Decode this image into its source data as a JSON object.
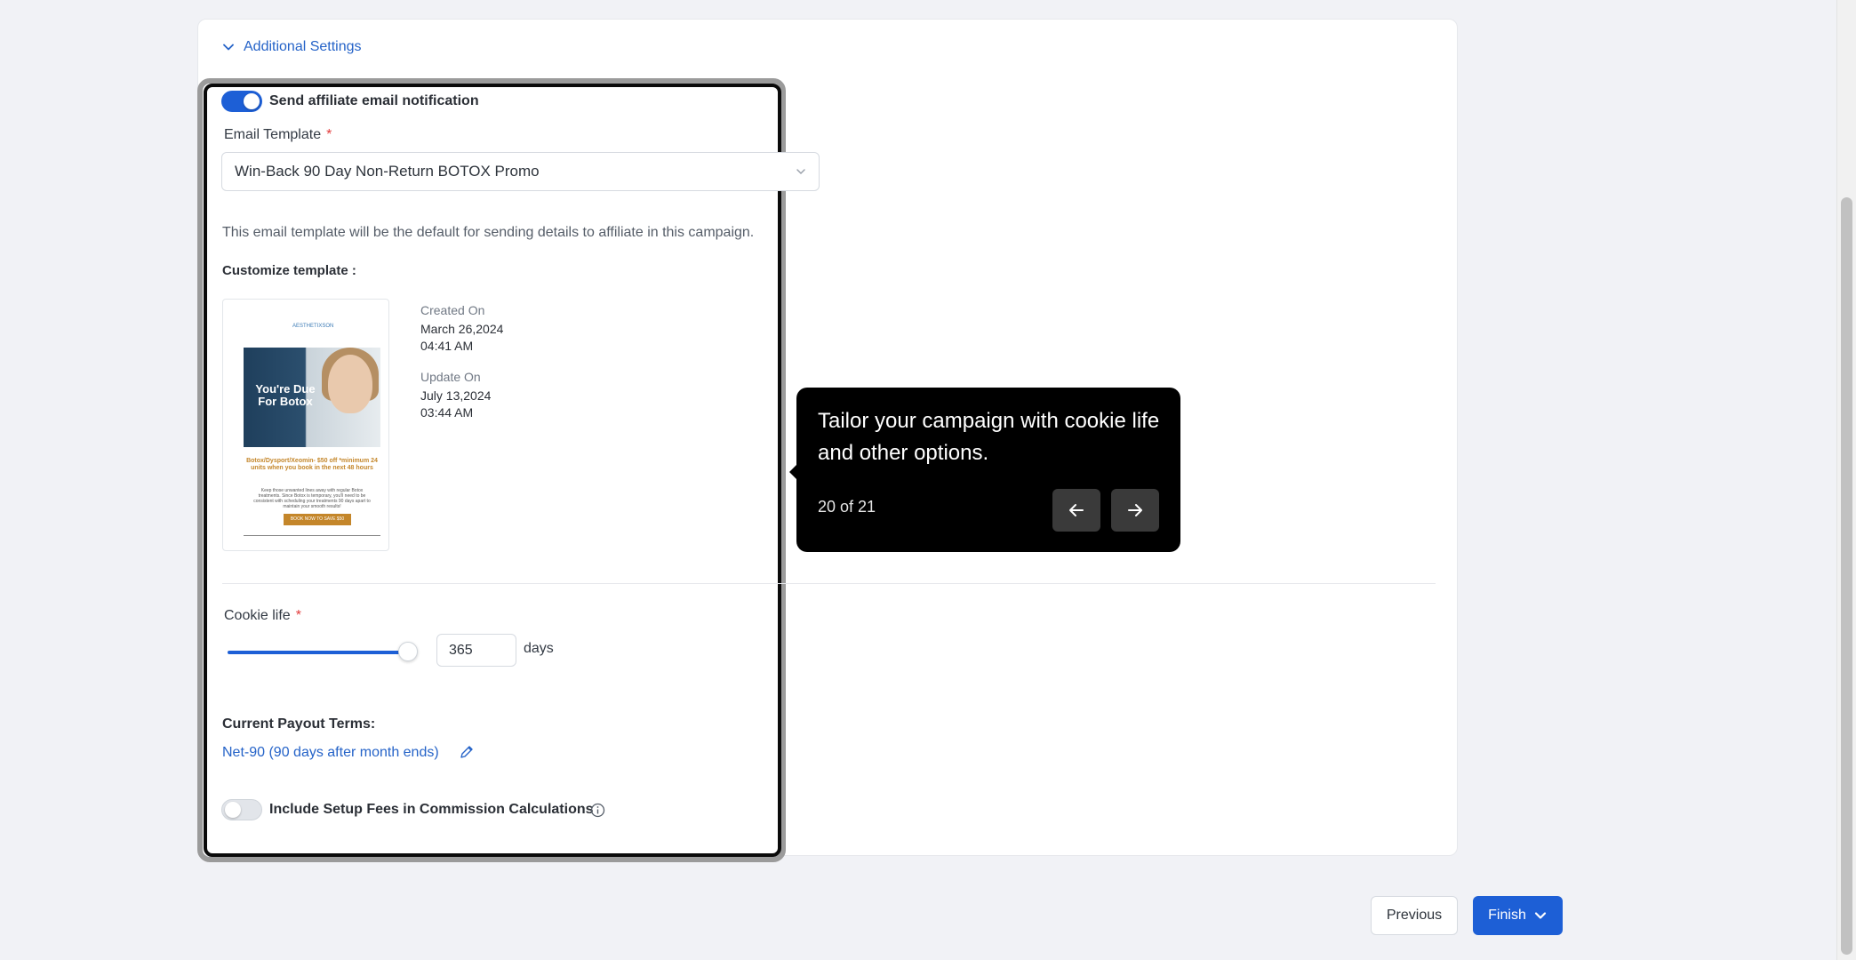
{
  "accordion": {
    "label": "Additional Settings",
    "icon": "chevron-down-icon",
    "color": "#2563c8"
  },
  "affiliate_email": {
    "toggle_on": true,
    "label": "Send affiliate email notification"
  },
  "email_template": {
    "label": "Email Template",
    "required_mark": "*",
    "selected": "Win-Back 90 Day Non-Return BOTOX Promo",
    "help": "This email template will be the default for sending details to affiliate in this campaign."
  },
  "customize": {
    "label": "Customize template :",
    "preview": {
      "logo": "AESTHETIXSON",
      "headline": "You're Due For Botox",
      "promo": "Botox/Dysport/Xeomin- $50 off *minimum 24 units when you book in the next 48 hours",
      "body": "Keep those unwanted lines away with regular Botox treatments. Since Botox is temporary, you'll need to be consistent with scheduling your treatments 90 days apart to maintain your smooth results!",
      "cta": "BOOK NOW TO SAVE $50"
    },
    "created_label": "Created On",
    "created_date": "March 26,2024",
    "created_time": "04:41 AM",
    "updated_label": "Update On",
    "updated_date": "July 13,2024",
    "updated_time": "03:44 AM"
  },
  "cookie_life": {
    "label": "Cookie life",
    "required_mark": "*",
    "value": "365",
    "unit": "days",
    "slider_fraction": 1.0
  },
  "payout": {
    "label": "Current Payout Terms:",
    "value": "Net-90 (90 days after month ends)"
  },
  "setup_fees": {
    "toggle_on": false,
    "label": "Include Setup Fees in Commission Calculations"
  },
  "tour": {
    "text": "Tailor your campaign with cookie life and other options.",
    "step": "20 of 21"
  },
  "footer": {
    "previous": "Previous",
    "finish": "Finish"
  },
  "colors": {
    "primary": "#1d5fd6",
    "link": "#2563c8",
    "tooltip_bg": "#000000"
  }
}
